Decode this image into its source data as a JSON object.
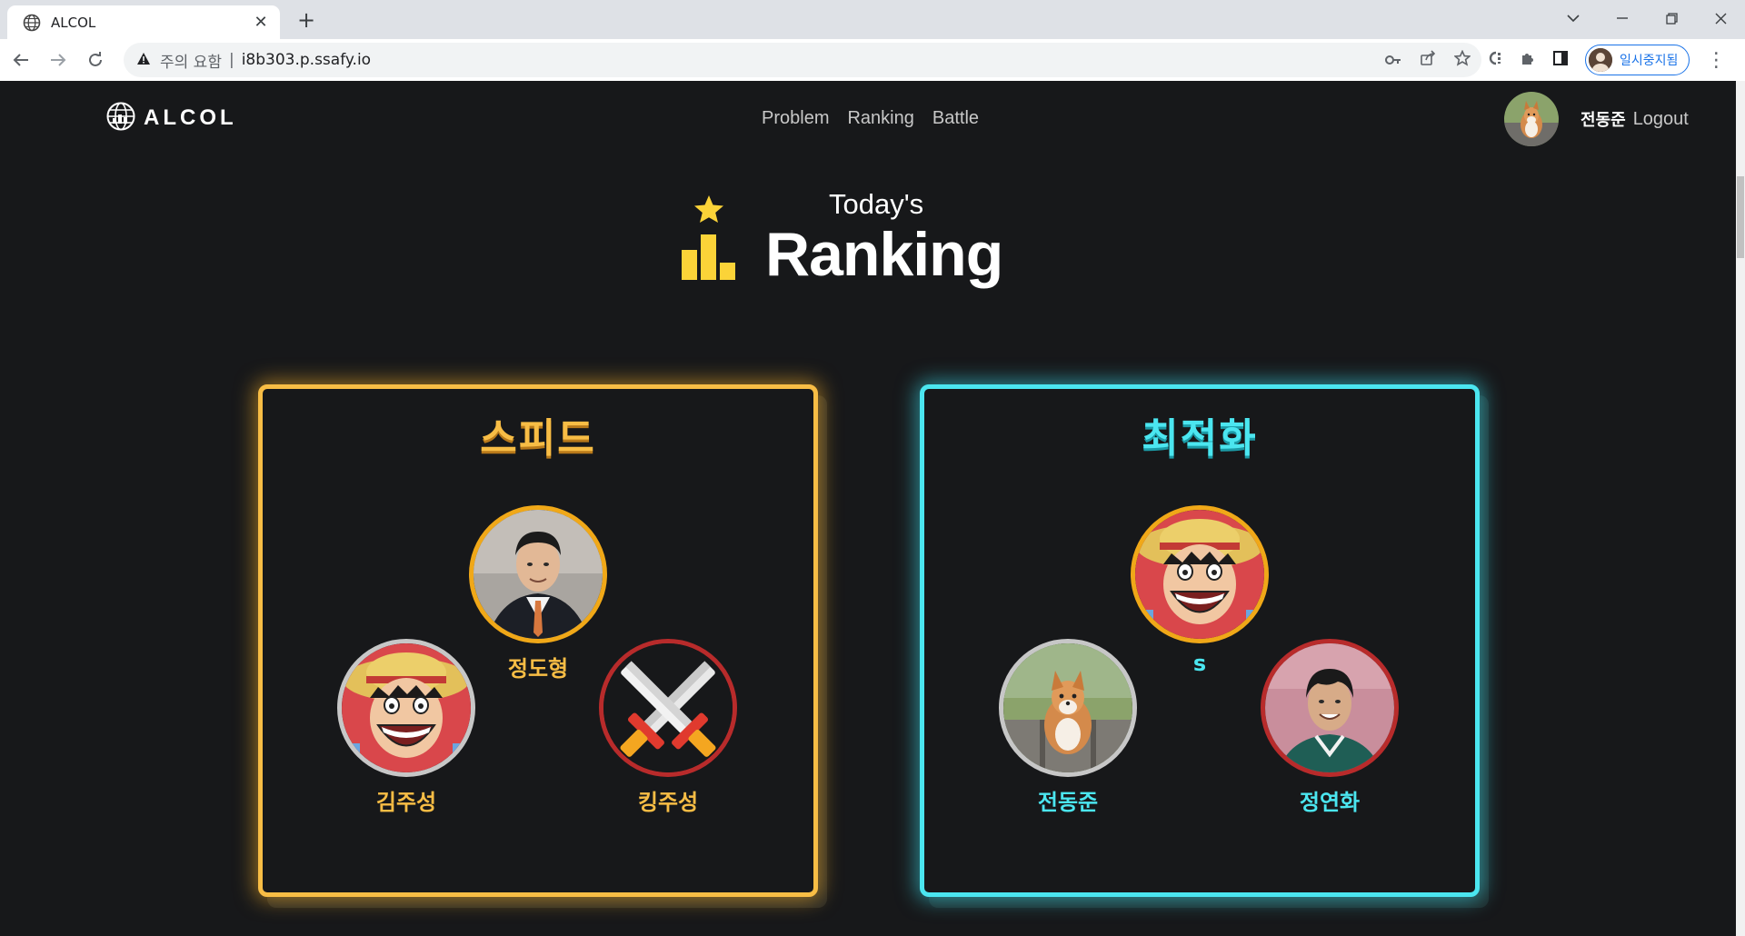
{
  "browser": {
    "tab_title": "ALCOL",
    "security_warning": "주의 요함",
    "url": "i8b303.p.ssafy.io",
    "profile_label": "일시중지됨"
  },
  "site": {
    "logo_text": "ALCOL",
    "nav": [
      "Problem",
      "Ranking",
      "Battle"
    ],
    "user_name": "전동준",
    "logout_label": "Logout"
  },
  "hero": {
    "subtitle": "Today's",
    "title": "Ranking"
  },
  "cards": {
    "speed": {
      "title": "스피드",
      "accent": "#f8bd45",
      "first": "정도형",
      "second": "김주성",
      "third": "킹주성"
    },
    "optimization": {
      "title": "최적화",
      "accent": "#4be6f0",
      "first": "s",
      "second": "전동준",
      "third": "정연화"
    }
  }
}
